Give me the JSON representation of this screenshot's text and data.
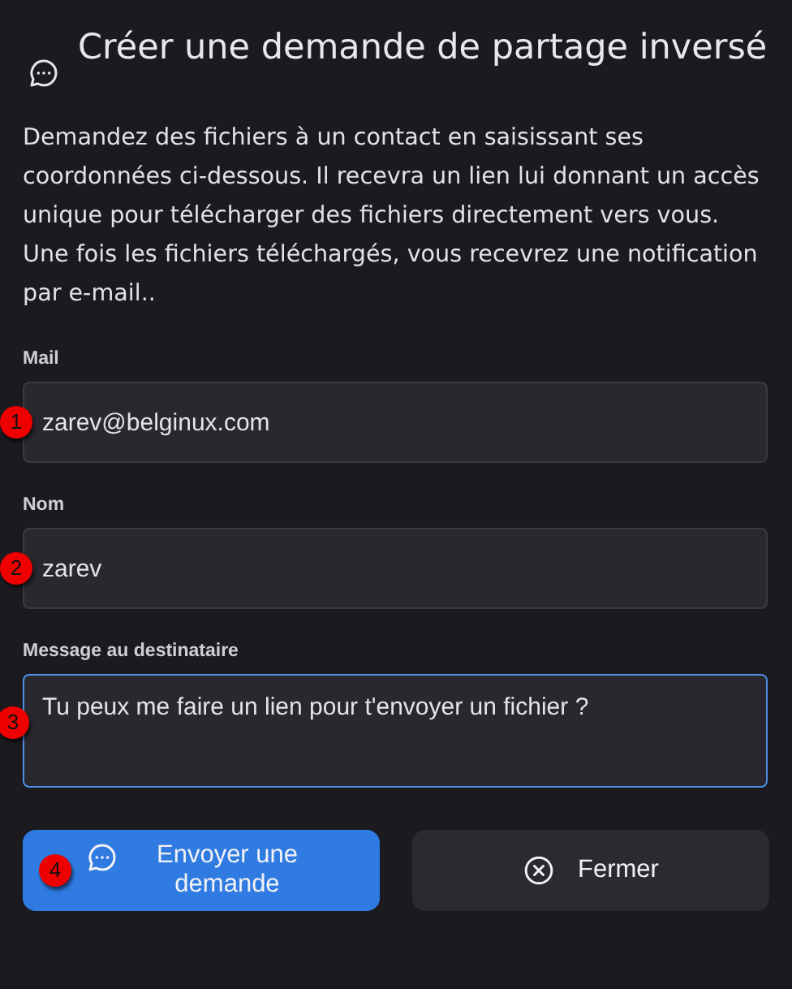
{
  "dialog": {
    "title": "Créer une demande de partage inversé",
    "description": "Demandez des fichiers à un contact en saisissant ses coordonnées ci-dessous. Il recevra un lien lui donnant un accès unique pour télécharger des fichiers directement vers vous. Une fois les fichiers téléchargés, vous recevrez une notification par e-mail..",
    "fields": [
      {
        "kind": "input",
        "label": "Mail",
        "value": "zarev@belginux.com",
        "focused": false,
        "marker": "1"
      },
      {
        "kind": "input",
        "label": "Nom",
        "value": "zarev",
        "focused": false,
        "marker": "2"
      },
      {
        "kind": "textarea",
        "label": "Message au destinataire",
        "value": "Tu peux me faire un lien pour t'envoyer un fichier ?",
        "focused": true,
        "marker": "3"
      }
    ],
    "buttons": [
      {
        "kind": "primary",
        "label": "Envoyer une demande",
        "marker": "4"
      },
      {
        "kind": "secondary",
        "label": "Fermer"
      }
    ]
  }
}
